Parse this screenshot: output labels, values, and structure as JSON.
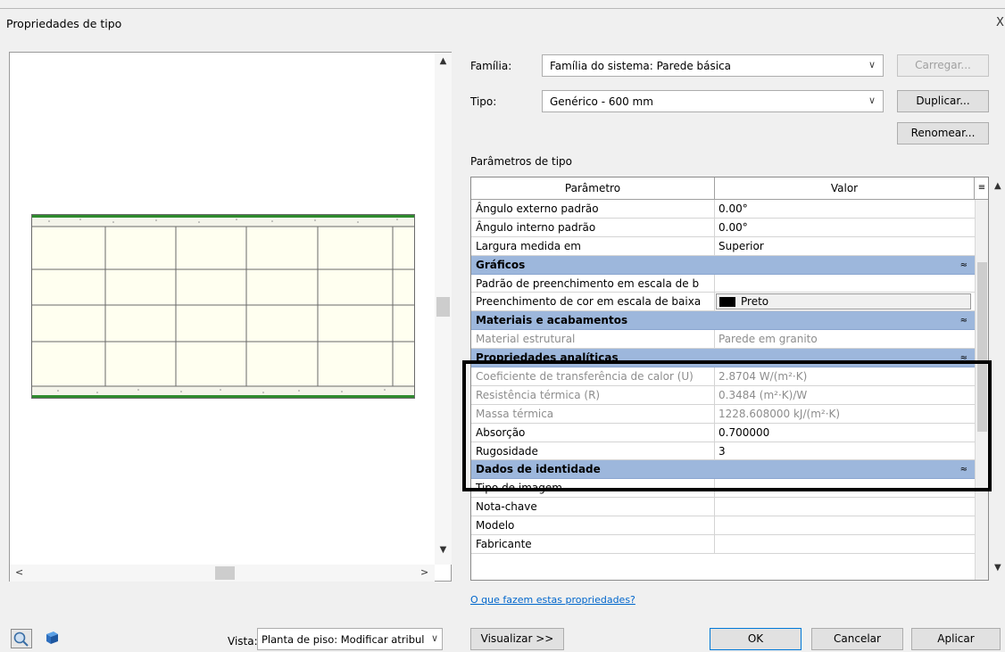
{
  "window": {
    "title": "Propriedades de tipo",
    "close_glyph": "X"
  },
  "family": {
    "label": "Família:",
    "value": "Família do sistema: Parede básica"
  },
  "type": {
    "label": "Tipo:",
    "value": "Genérico - 600 mm"
  },
  "buttons": {
    "load": "Carregar...",
    "duplicate": "Duplicar...",
    "rename": "Renomear...",
    "preview": "Visualizar >>",
    "ok": "OK",
    "cancel": "Cancelar",
    "apply": "Aplicar"
  },
  "params_section_label": "Parâmetros de tipo",
  "table": {
    "col_param": "Parâmetro",
    "col_value": "Valor",
    "col_icon": "≡",
    "collapse_glyph": "≈",
    "rows": [
      {
        "kind": "row",
        "param": "Ângulo externo padrão",
        "value": "0.00°"
      },
      {
        "kind": "row",
        "param": "Ângulo interno padrão",
        "value": "0.00°"
      },
      {
        "kind": "row",
        "param": "Largura medida em",
        "value": "Superior"
      },
      {
        "kind": "group",
        "param": "Gráficos"
      },
      {
        "kind": "row",
        "param": "Padrão de preenchimento em escala de b",
        "value": ""
      },
      {
        "kind": "swatch",
        "param": "Preenchimento de cor em escala de baixa",
        "value": "Preto"
      },
      {
        "kind": "group",
        "param": "Materiais e acabamentos"
      },
      {
        "kind": "grey",
        "param": "Material estrutural",
        "value": "Parede em granito"
      },
      {
        "kind": "group",
        "param": "Propriedades analíticas"
      },
      {
        "kind": "grey",
        "param": "Coeficiente de transferência de calor (U)",
        "value": "2.8704 W/(m²·K)"
      },
      {
        "kind": "grey",
        "param": "Resistência térmica (R)",
        "value": "0.3484 (m²·K)/W"
      },
      {
        "kind": "grey",
        "param": "Massa térmica",
        "value": "1228.608000 kJ/(m²·K)"
      },
      {
        "kind": "row",
        "param": "Absorção",
        "value": "0.700000"
      },
      {
        "kind": "row",
        "param": "Rugosidade",
        "value": "3"
      },
      {
        "kind": "group",
        "param": "Dados de identidade"
      },
      {
        "kind": "row",
        "param": "Tipo de imagem",
        "value": ""
      },
      {
        "kind": "row",
        "param": "Nota-chave",
        "value": ""
      },
      {
        "kind": "row",
        "param": "Modelo",
        "value": ""
      },
      {
        "kind": "row",
        "param": "Fabricante",
        "value": ""
      }
    ]
  },
  "help_link": "O que fazem estas propriedades?",
  "view": {
    "label": "Vista:",
    "value": "Planta de piso: Modificar atribul"
  },
  "icons": {
    "zoom": "zoom-icon",
    "cube": "3d-view-icon",
    "scroll_up": "▲",
    "scroll_down": "▼",
    "scroll_left": "<",
    "scroll_right": ">",
    "chevron": "∨"
  },
  "colors": {
    "group_header": "#9db7dc",
    "wall_fill": "#fffff0",
    "wall_edge": "#2e8b2e",
    "link": "#0066cc"
  }
}
